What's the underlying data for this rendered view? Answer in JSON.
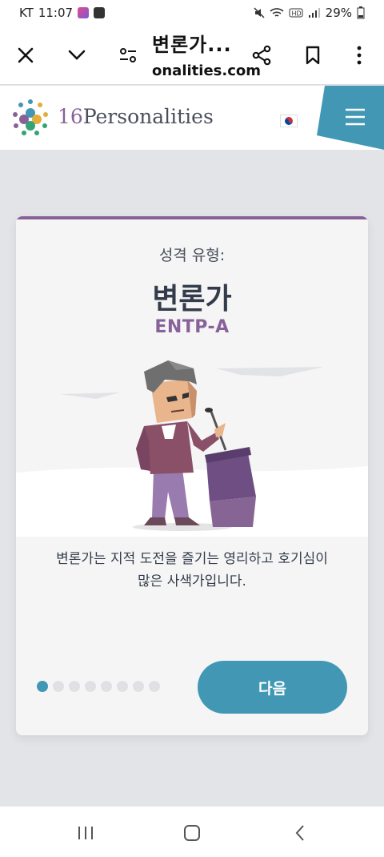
{
  "status_bar": {
    "carrier": "KT",
    "time": "11:07",
    "battery": "29%"
  },
  "browser": {
    "title": "변론가...",
    "url": "onalities.com"
  },
  "site": {
    "logo_num": "16",
    "logo_word": "Personalities"
  },
  "card": {
    "kicker": "성격 유형:",
    "type_name": "변론가",
    "type_code": "ENTP-A",
    "description_line1": "변론가는 지적 도전을 즐기는 영리하고 호기심이",
    "description_line2": "많은 사색가입니다.",
    "next_label": "다음",
    "slides_total": 8,
    "slide_current": 1
  },
  "colors": {
    "accent_purple": "#88619a",
    "accent_blue": "#4298b4",
    "text_dark": "#343c4b"
  }
}
